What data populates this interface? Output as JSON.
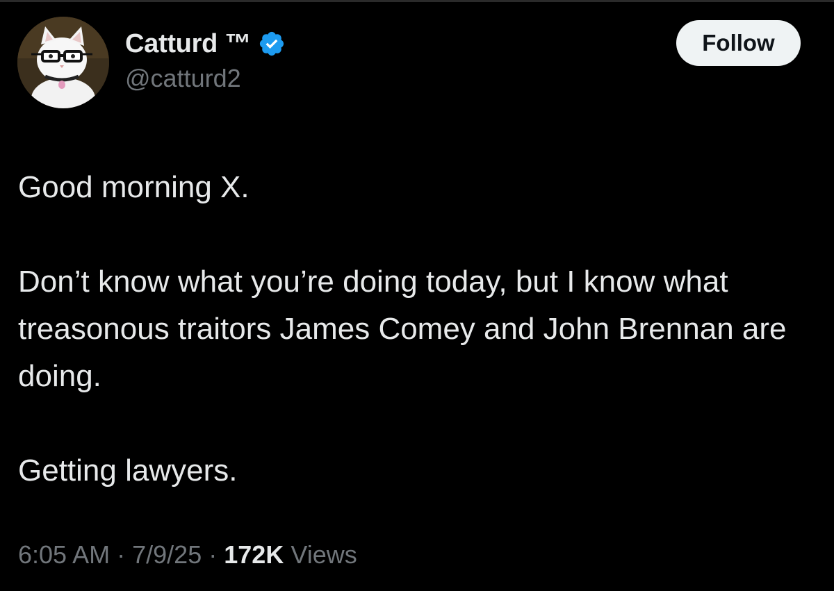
{
  "author": {
    "display_name": "Catturd ™",
    "handle": "@catturd2",
    "verified_icon": "verified-badge-icon",
    "avatar": "cat-with-glasses-avatar"
  },
  "follow_button": {
    "label": "Follow"
  },
  "tweet": {
    "paragraphs": [
      "Good morning X.",
      "Don’t know what you’re doing today, but I know what treasonous traitors James Comey and John Brennan are doing.",
      "Getting lawyers."
    ]
  },
  "meta": {
    "time": "6:05 AM",
    "separator": "·",
    "date": "7/9/25",
    "views_count": "172K",
    "views_label": "Views"
  },
  "colors": {
    "background": "#000000",
    "text_primary": "#e7e9ea",
    "text_secondary": "#71767b",
    "verified_blue": "#1d9bf0",
    "follow_bg": "#eff3f4"
  }
}
